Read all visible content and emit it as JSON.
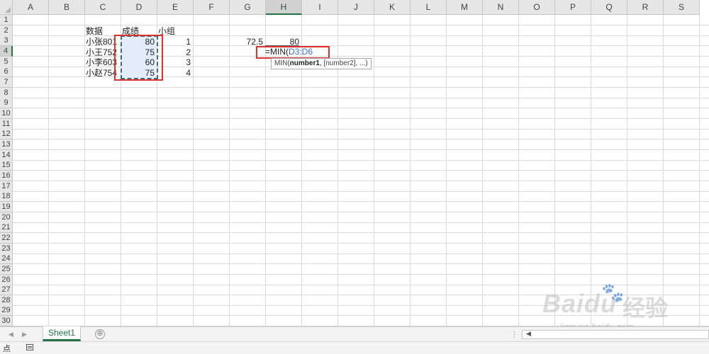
{
  "columns": [
    "A",
    "B",
    "C",
    "D",
    "E",
    "F",
    "G",
    "H",
    "I",
    "J",
    "K",
    "L",
    "M",
    "N",
    "O",
    "P",
    "Q",
    "R",
    "S"
  ],
  "rows": [
    "1",
    "2",
    "3",
    "4",
    "5",
    "6",
    "7",
    "8",
    "9",
    "10",
    "11",
    "12",
    "13",
    "14",
    "15",
    "16",
    "17",
    "18",
    "19",
    "20",
    "21",
    "22",
    "23",
    "24",
    "25",
    "26",
    "27",
    "28",
    "29",
    "30"
  ],
  "headers_row": {
    "c2": "数据",
    "d2": "成绩",
    "e2": "小组"
  },
  "data_rows": [
    {
      "name": "小张801",
      "score": "80",
      "group": "1"
    },
    {
      "name": "小王752",
      "score": "75",
      "group": "2"
    },
    {
      "name": "小李603",
      "score": "60",
      "group": "3"
    },
    {
      "name": "小赵754",
      "score": "75",
      "group": "4"
    }
  ],
  "g3_value": "72.5",
  "h3_value": "80",
  "formula": {
    "prefix": "=MIN(",
    "ref": "D3:D6"
  },
  "tooltip": {
    "func": "MIN(",
    "arg1": "number1",
    "rest": ", [number2], ...)"
  },
  "sheet_tab": "Sheet1",
  "add_sheet": "⊕",
  "status_mode": "点",
  "watermark": {
    "logo": "Baidu",
    "cn": "经验",
    "url": "jingyan.baidu.com"
  },
  "accent_color": "#217346",
  "highlight_color": "#e0312f"
}
